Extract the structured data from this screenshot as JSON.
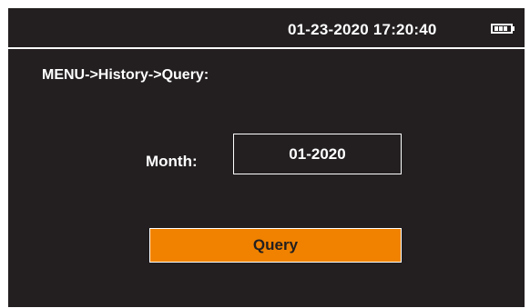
{
  "status_bar": {
    "datetime": "01-23-2020 17:20:40",
    "battery_icon": "battery-icon"
  },
  "breadcrumb": "MENU->History->Query:",
  "form": {
    "month_label": "Month:",
    "month_value": "01-2020"
  },
  "query_button": {
    "label": "Query"
  },
  "colors": {
    "background": "#231f20",
    "accent": "#f08200",
    "text": "#ffffff",
    "button_text": "#231f20"
  }
}
